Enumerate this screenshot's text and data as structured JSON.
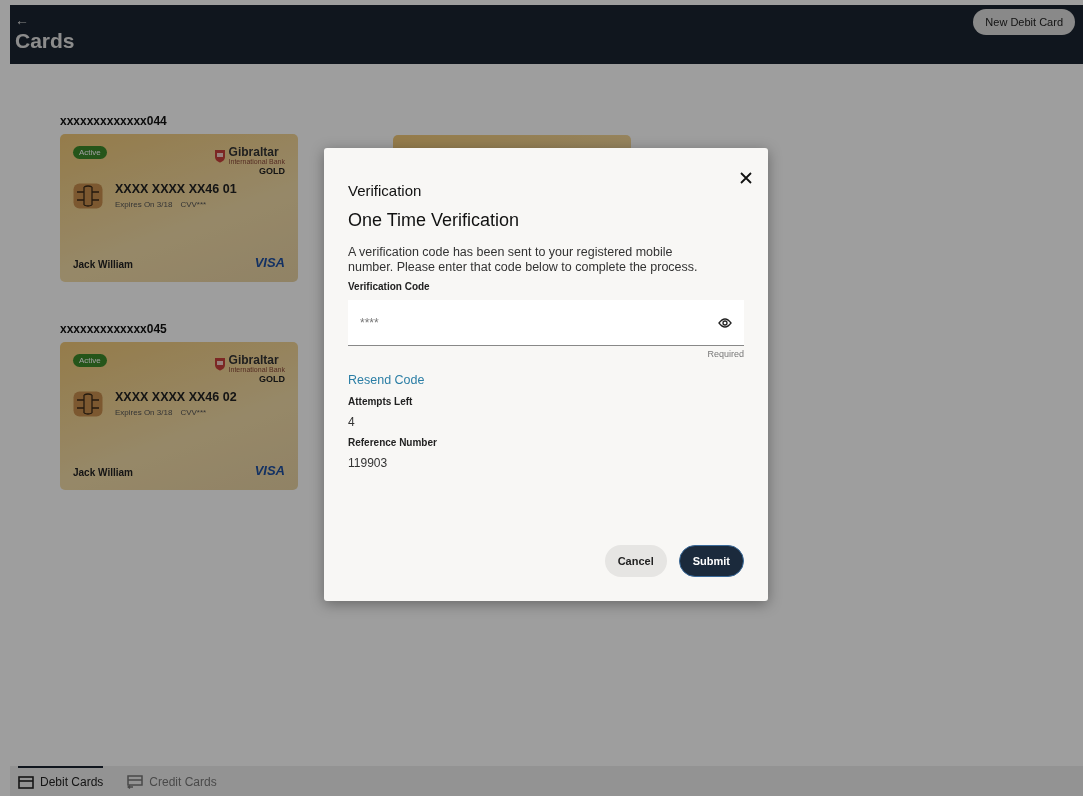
{
  "header": {
    "back": "←",
    "title": "Cards",
    "action": "New Debit Card"
  },
  "cards": [
    {
      "masked_number": "xxxxxxxxxxxxx044",
      "status": "Active",
      "bank": "Gibraltar",
      "bank_sub": "International Bank",
      "tier": "GOLD",
      "number": "XXXX XXXX XX46 01",
      "expiry": "Expires On 3/18",
      "cvv": "CVV***",
      "holder": "Jack William",
      "network": "VISA"
    },
    {
      "masked_number": "xxxxxxxxxxxxx045",
      "status": "Active",
      "bank": "Gibraltar",
      "bank_sub": "International Bank",
      "tier": "GOLD",
      "number": "XXXX XXXX XX46 02",
      "expiry": "Expires On 3/18",
      "cvv": "CVV***",
      "holder": "Jack William",
      "network": "VISA"
    }
  ],
  "modal": {
    "title": "Verification",
    "heading": "One Time Verification",
    "message": "A verification code has been sent to your registered mobile number. Please enter that code below to complete the process.",
    "field": {
      "label": "Verification Code",
      "placeholder": "****",
      "helper": "Required"
    },
    "resend": "Resend Code",
    "details": [
      {
        "label": "Attempts Left",
        "value": "4"
      },
      {
        "label": "Reference Number",
        "value": "119903"
      }
    ],
    "buttons": [
      {
        "label": "Cancel",
        "kind": "secondary"
      },
      {
        "label": "Submit",
        "kind": "primary"
      }
    ]
  },
  "tabs": [
    {
      "label": "Debit Cards",
      "selected": true
    },
    {
      "label": "Credit Cards",
      "selected": false
    }
  ]
}
